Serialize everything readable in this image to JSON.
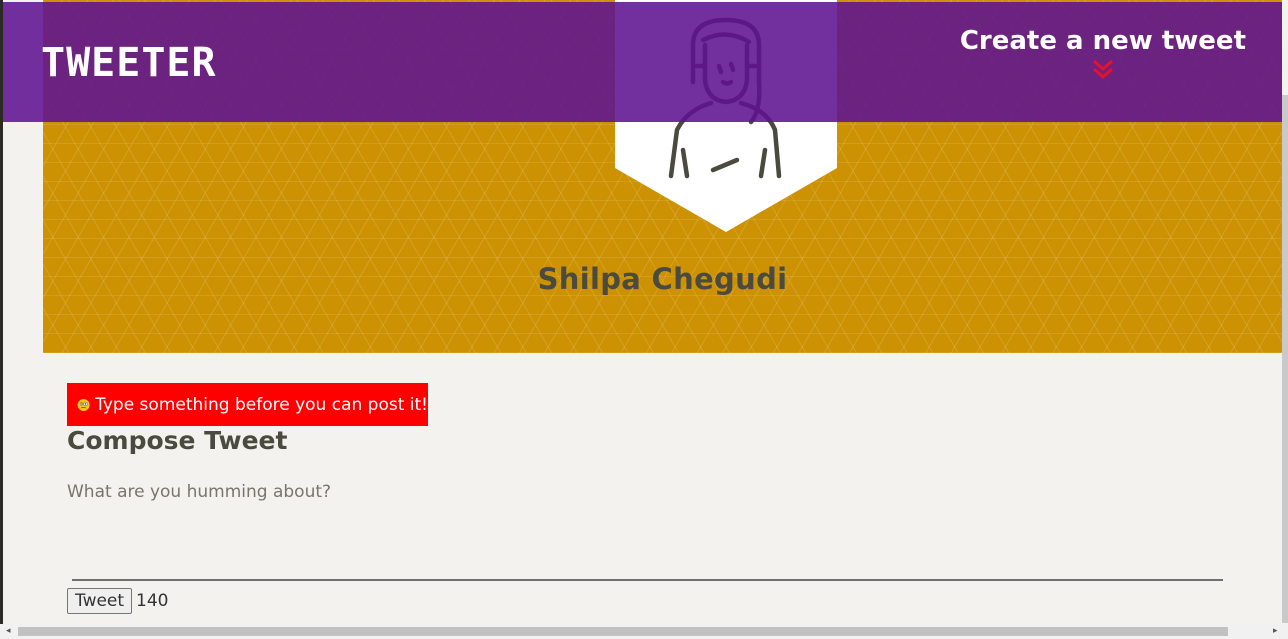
{
  "nav": {
    "logo": "TWEETER",
    "new_tweet_label": "Create a new tweet",
    "new_tweet_icon": "double-chevron-down-icon",
    "accent_color": "#e8102a",
    "bar_color": "#5f1291"
  },
  "profile": {
    "name": "Shilpa Chegudi",
    "avatar_icon": "person-avatar-icon",
    "banner_color": "#cd9203"
  },
  "compose": {
    "error_icon": "confused-face-emoji-icon",
    "error_message": "Type something before you can post it!",
    "error_color": "#ff0000",
    "title": "Compose Tweet",
    "input_placeholder": "What are you humming about?",
    "input_value": "",
    "submit_label": "Tweet",
    "char_counter": "140"
  }
}
